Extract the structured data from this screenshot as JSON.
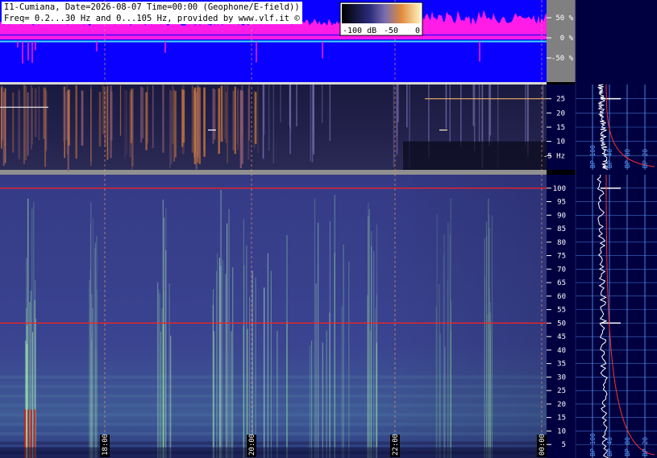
{
  "header": {
    "line1": "I1-Cumiana, Date=2026-08-07 Time=00:00 (Geophone/E-field))",
    "line2": "Freq= 0.2...30 Hz and 0...105 Hz, provided by www.vlf.it ©"
  },
  "colorbar": {
    "labels": [
      "-100 dB",
      "-50",
      "0"
    ]
  },
  "colors": {
    "amp_bg": "#0a00ff",
    "amp_trace": "#ff1ce6",
    "background_panel": "#000040",
    "grid": "#5aa0ff",
    "marker_line": "#ff2020",
    "spectrum_trace": "#ffffff",
    "reference_curve": "#ff3030"
  },
  "chart_data": [
    {
      "type": "area",
      "name": "amplitude_strip",
      "yaxis": {
        "ticks": [
          50,
          0,
          -50
        ],
        "tick_labels": [
          "50 %",
          "0 %",
          "-50 %"
        ]
      }
    },
    {
      "type": "heatmap",
      "name": "spectrogram_low",
      "ylim": [
        0,
        30
      ],
      "yaxis": {
        "ticks": [
          5,
          10,
          15,
          20,
          25
        ],
        "tick_labels": [
          "-5 Hz",
          "10",
          "15",
          "20",
          "25"
        ]
      },
      "side_panel_labels": [
        "BP 100",
        "BP 40",
        "BP 80",
        "BP 20"
      ]
    },
    {
      "type": "heatmap",
      "name": "spectrogram_high",
      "ylim": [
        0,
        105
      ],
      "yaxis": {
        "ticks": [
          5,
          10,
          15,
          20,
          25,
          30,
          35,
          40,
          45,
          50,
          55,
          60,
          65,
          70,
          75,
          80,
          85,
          90,
          95,
          100
        ],
        "tick_labels": [
          "5",
          "10",
          "15",
          "20",
          "25",
          "30",
          "35",
          "40",
          "45",
          "50",
          "55",
          "60",
          "65",
          "70",
          "75",
          "80",
          "85",
          "90",
          "95",
          "100"
        ]
      },
      "xaxis": {
        "time_labels": [
          "18:00",
          "20:00",
          "22:00",
          "00:00"
        ]
      },
      "horizontal_markers_hz": [
        50,
        100
      ],
      "side_panel_labels": [
        "BP 100",
        "BP 40",
        "BP 80",
        "BP 20"
      ]
    }
  ]
}
